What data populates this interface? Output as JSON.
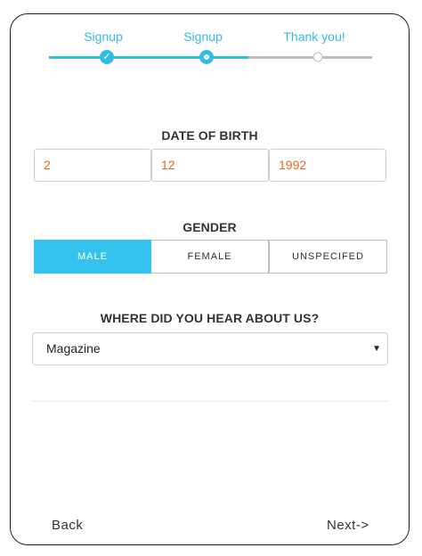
{
  "progress": {
    "steps": [
      {
        "label": "Signup",
        "state": "complete",
        "icon": "check-icon",
        "glyph": "✓"
      },
      {
        "label": "Signup",
        "state": "active"
      },
      {
        "label": "Thank you!",
        "state": "pending"
      }
    ]
  },
  "dob": {
    "title": "DATE OF BIRTH",
    "day": "2",
    "month": "12",
    "year": "1992"
  },
  "gender": {
    "title": "GENDER",
    "options": [
      "MALE",
      "FEMALE",
      "UNSPECIFED"
    ],
    "selected": "MALE"
  },
  "referral": {
    "title": "WHERE DID YOU HEAR ABOUT US?",
    "selected": "Magazine",
    "caret_icon": "caret-down-icon",
    "caret": "▼"
  },
  "nav": {
    "back": "Back",
    "next": "Next->"
  },
  "colors": {
    "accent": "#33bbe8",
    "value_text": "#e2671c",
    "inactive_track": "#bdbdbd"
  }
}
